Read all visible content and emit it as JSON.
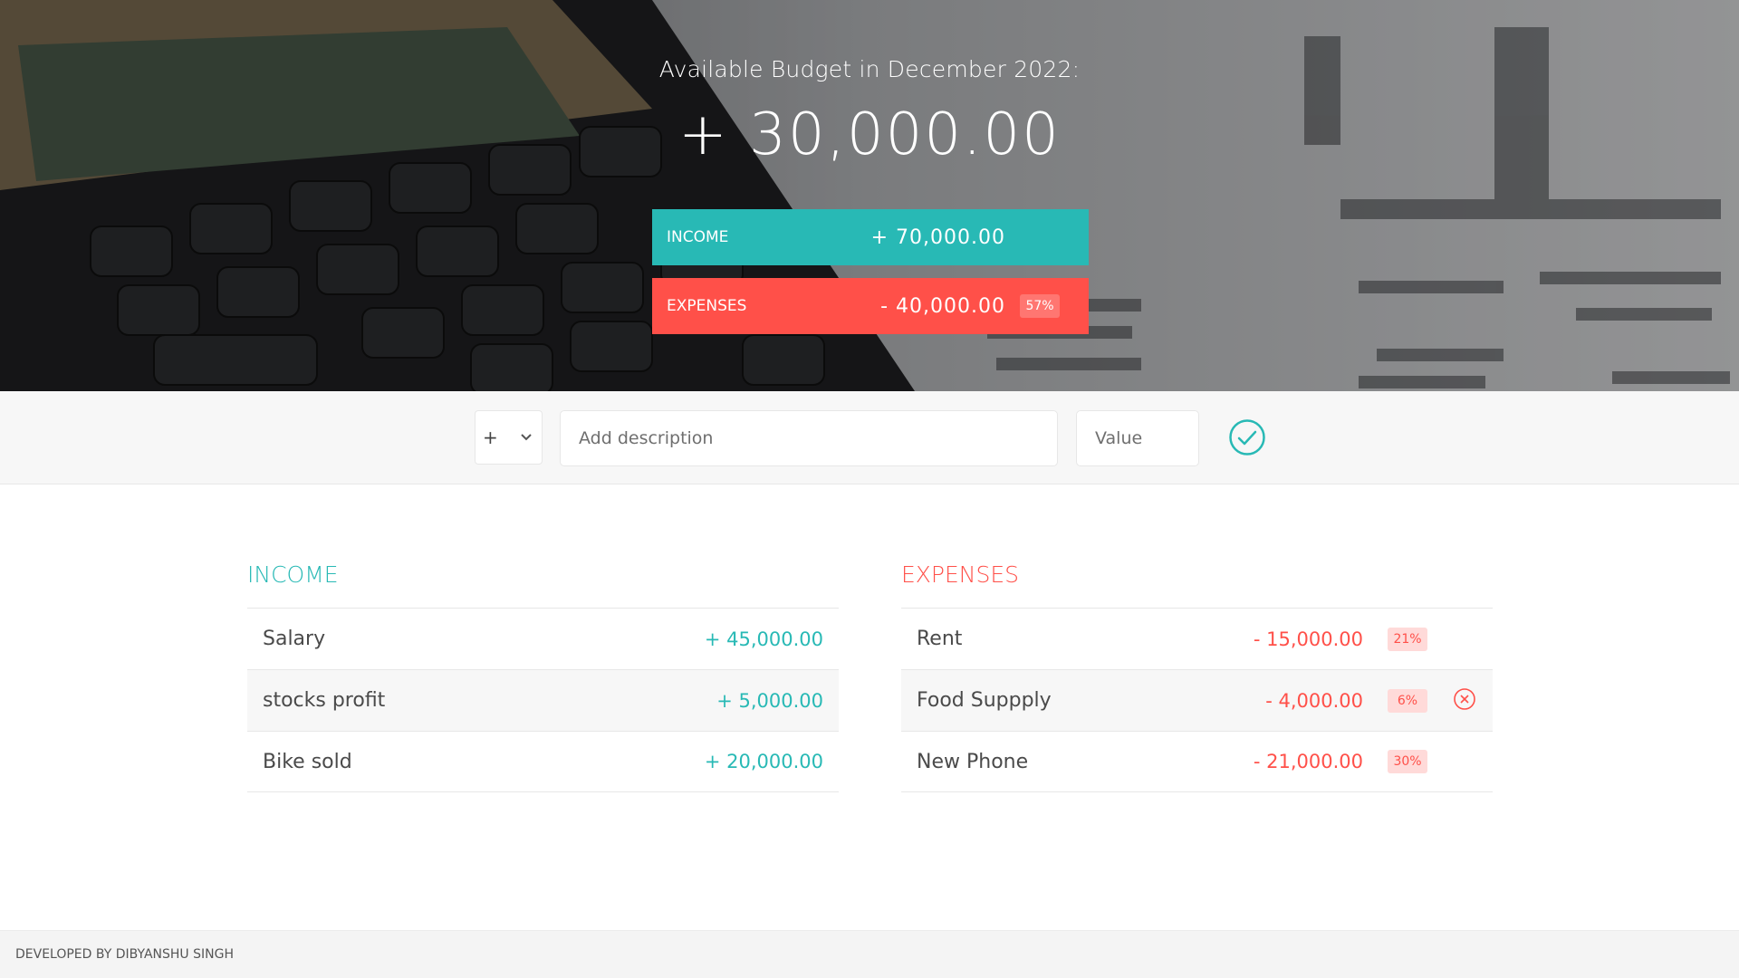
{
  "budget": {
    "title": "Available Budget in December 2022:",
    "value": "+ 30,000.00",
    "income_label": "Income",
    "income_value": "+ 70,000.00",
    "expenses_label": "Expenses",
    "expenses_value": "- 40,000.00",
    "expenses_percentage": "57%"
  },
  "add_form": {
    "type_selected": "+",
    "description_placeholder": "Add description",
    "value_placeholder": "Value",
    "submit_icon": "check-circle-icon"
  },
  "income": {
    "title": "Income",
    "items": [
      {
        "description": "Salary",
        "value": "+ 45,000.00"
      },
      {
        "description": "stocks profit",
        "value": "+ 5,000.00"
      },
      {
        "description": "Bike sold",
        "value": "+ 20,000.00"
      }
    ]
  },
  "expenses": {
    "title": "Expenses",
    "items": [
      {
        "description": "Rent",
        "value": "- 15,000.00",
        "percentage": "21%"
      },
      {
        "description": "Food Suppply",
        "value": "- 4,000.00",
        "percentage": "6%"
      },
      {
        "description": "New Phone",
        "value": "- 21,000.00",
        "percentage": "30%"
      }
    ],
    "delete_icon": "close-circle-icon"
  },
  "footer": {
    "text": "Developed by Dibyanshu Singh"
  },
  "colors": {
    "income": "#28b9b5",
    "expenses": "#ff5049",
    "percentage_badge_bg": "#ffdad9"
  }
}
